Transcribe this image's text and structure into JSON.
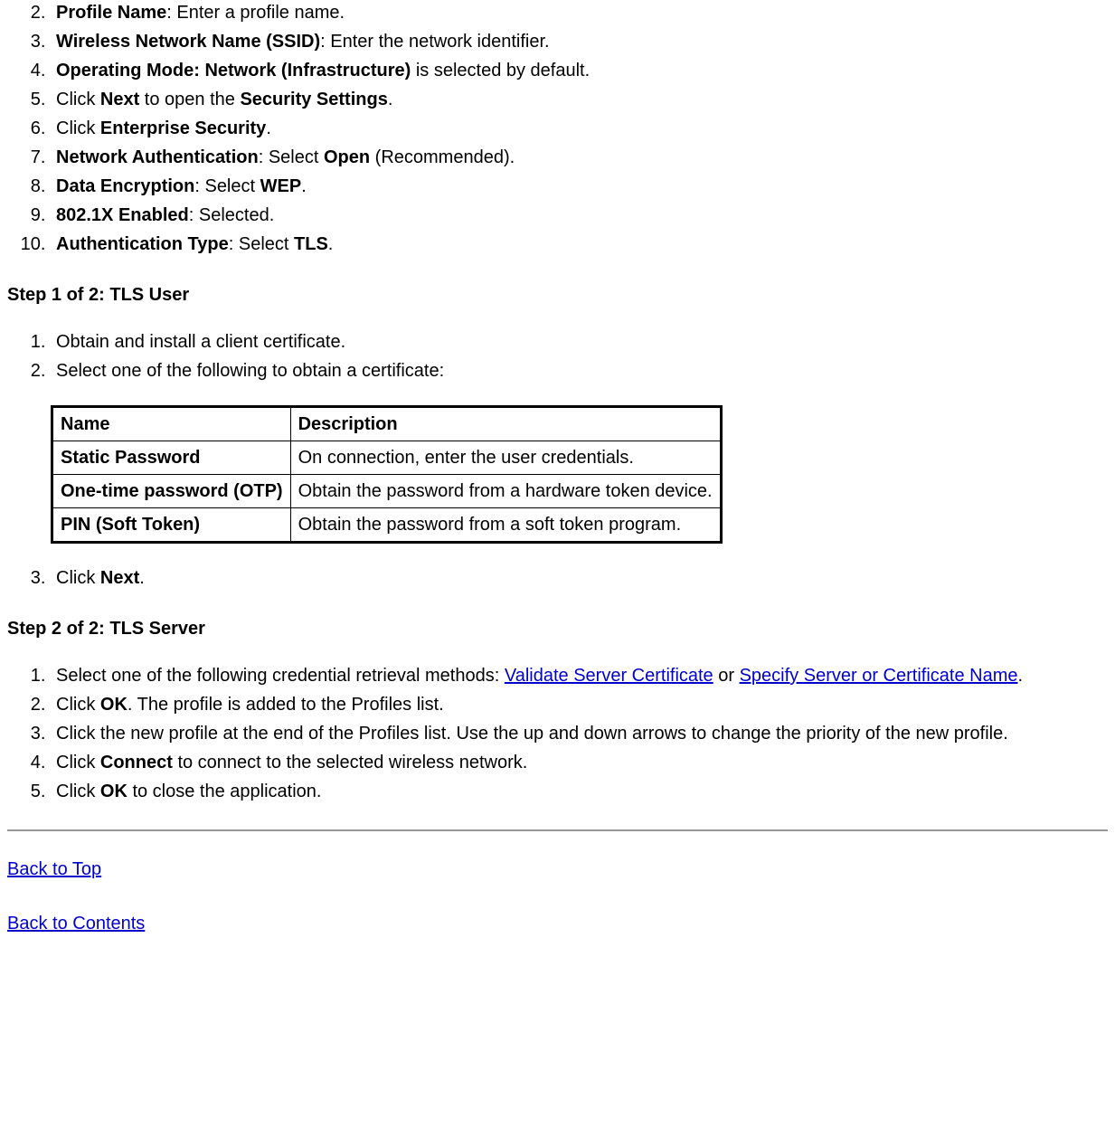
{
  "topList": {
    "start": 2,
    "items": [
      {
        "bold": "Profile Name",
        "rest": ": Enter a profile name."
      },
      {
        "bold": "Wireless Network Name (SSID)",
        "rest": ": Enter the network identifier."
      },
      {
        "bold": "Operating Mode: Network (Infrastructure)",
        "rest": " is selected by default."
      },
      {
        "pre": "Click ",
        "bold1": "Next",
        "mid": " to open the ",
        "bold2": "Security Settings",
        "post": "."
      },
      {
        "pre": "Click ",
        "bold1": "Enterprise Security",
        "post": "."
      },
      {
        "bold": "Network Authentication",
        "mid1": ": Select ",
        "bold2": "Open",
        "post": " (Recommended)."
      },
      {
        "bold": "Data Encryption",
        "mid1": ": Select ",
        "bold2": "WEP",
        "post": "."
      },
      {
        "bold": "802.1X Enabled",
        "rest": ": Selected."
      },
      {
        "bold": "Authentication Type",
        "mid1": ": Select ",
        "bold2": "TLS",
        "post": "."
      }
    ]
  },
  "step1": {
    "heading": "Step 1 of 2: TLS User",
    "list": [
      "Obtain and install a client certificate.",
      "Select one of the following to obtain a certificate:"
    ],
    "table": {
      "headers": [
        "Name",
        "Description"
      ],
      "rows": [
        [
          "Static Password",
          "On connection, enter the user credentials."
        ],
        [
          "One-time password (OTP)",
          "Obtain the password from a hardware token device."
        ],
        [
          "PIN (Soft Token)",
          "Obtain the password from a soft token program."
        ]
      ]
    },
    "list_after_start": 3,
    "list_after": [
      {
        "pre": "Click ",
        "bold": "Next",
        "post": "."
      }
    ]
  },
  "step2": {
    "heading": "Step 2 of 2: TLS Server",
    "list": [
      {
        "pre": "Select one of the following credential retrieval methods: ",
        "link1": "Validate Server Certificate",
        "mid": " or ",
        "link2": "Specify Server or Certificate Name",
        "post": "."
      },
      {
        "pre": "Click ",
        "bold": "OK",
        "post": ". The profile is added to the Profiles list."
      },
      {
        "text": "Click the new profile at the end of the Profiles list. Use the up and down arrows to change the priority of the new profile."
      },
      {
        "pre": "Click ",
        "bold": "Connect",
        "post": " to connect to the selected wireless network."
      },
      {
        "pre": "Click ",
        "bold": "OK",
        "post": " to close the application."
      }
    ]
  },
  "footer": {
    "backToTop": "Back to Top",
    "backToContents": "Back to Contents"
  }
}
